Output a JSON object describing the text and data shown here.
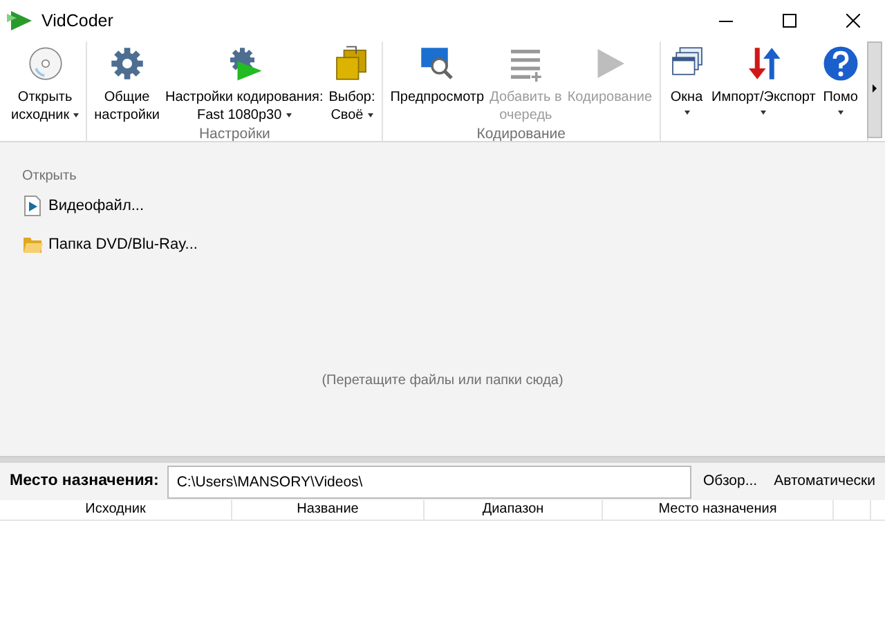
{
  "window": {
    "title": "VidCoder"
  },
  "ribbon": {
    "groups": [
      {
        "items": [
          {
            "kind": "disc",
            "label": "Открыть\nисходник",
            "dropdown": true,
            "disabled": false
          }
        ]
      },
      {
        "label": "Настройки",
        "items": [
          {
            "kind": "gear",
            "label": "Общие\nнастройки",
            "dropdown": false,
            "disabled": false
          },
          {
            "kind": "gear-play",
            "label": "Настройки кодирования:\nFast 1080p30",
            "dropdown": true,
            "disabled": false
          },
          {
            "kind": "folders",
            "label": "Выбор:\nСвоё",
            "dropdown": true,
            "disabled": false
          }
        ]
      },
      {
        "label": "Кодирование",
        "items": [
          {
            "kind": "preview",
            "label": "Предпросмотр",
            "dropdown": false,
            "disabled": false
          },
          {
            "kind": "queue",
            "label": "Добавить в\nочередь",
            "dropdown": false,
            "disabled": true
          },
          {
            "kind": "play",
            "label": "Кодирование",
            "dropdown": false,
            "disabled": true
          }
        ]
      },
      {
        "items": [
          {
            "kind": "windows",
            "label": "Окна",
            "dropdown": true,
            "disabled": false
          },
          {
            "kind": "arrows",
            "label": "Импорт/Экспорт",
            "dropdown": true,
            "disabled": false
          },
          {
            "kind": "help",
            "label": "Помо",
            "dropdown": true,
            "disabled": false
          }
        ]
      }
    ]
  },
  "open_panel": {
    "heading": "Открыть",
    "items": [
      {
        "kind": "video",
        "label": "Видеофайл..."
      },
      {
        "kind": "folder",
        "label": "Папка DVD/Blu-Ray..."
      }
    ],
    "drop_hint": "(Перетащите файлы или папки сюда)"
  },
  "destination": {
    "label": "Место назначения:",
    "value": "C:\\Users\\MANSORY\\Videos\\",
    "buttons": [
      "Обзор...",
      "Автоматически"
    ]
  },
  "table": {
    "columns": [
      "Исходник",
      "Название",
      "Диапазон",
      "Место назначения"
    ]
  }
}
